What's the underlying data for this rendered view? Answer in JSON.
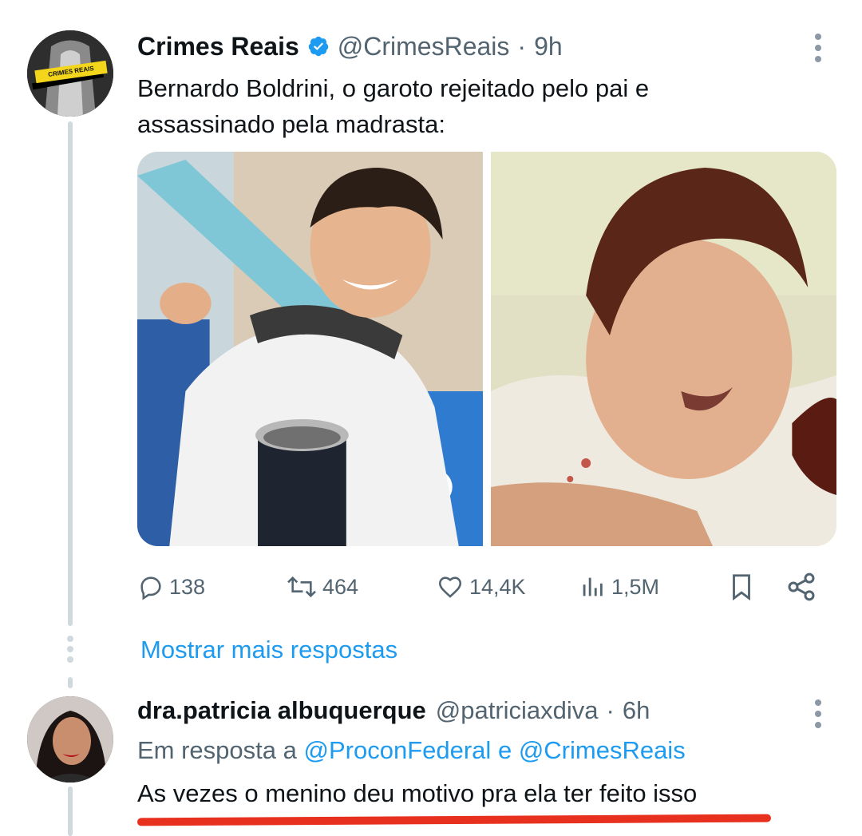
{
  "tweet": {
    "author_name": "Crimes Reais",
    "author_handle": "@CrimesReais",
    "time": "9h",
    "avatar_label": "CRIMES REAIS",
    "text": "Bernardo Boldrini, o garoto rejeitado pelo pai e assassinado pela madrasta:",
    "stats": {
      "replies": "138",
      "retweets": "464",
      "likes": "14,4K",
      "views": "1,5M"
    }
  },
  "show_more_replies": "Mostrar mais respostas",
  "reply": {
    "author_name": "dra.patricia albuquerque",
    "author_handle": "@patriciaxdiva",
    "time": "6h",
    "reply_prefix": "Em resposta a",
    "mention1": "@ProconFederal",
    "conjunction": "e",
    "mention2": "@CrimesReais",
    "text": "As vezes o menino deu motivo pra ela ter feito isso"
  },
  "colors": {
    "accent": "#1d9bf0",
    "text": "#0f1419",
    "muted": "#536471",
    "underline": "#e8301f"
  },
  "icons": [
    "verified-badge-icon",
    "more-options-icon",
    "reply-icon",
    "retweet-icon",
    "like-icon",
    "views-icon",
    "bookmark-icon",
    "share-icon"
  ]
}
